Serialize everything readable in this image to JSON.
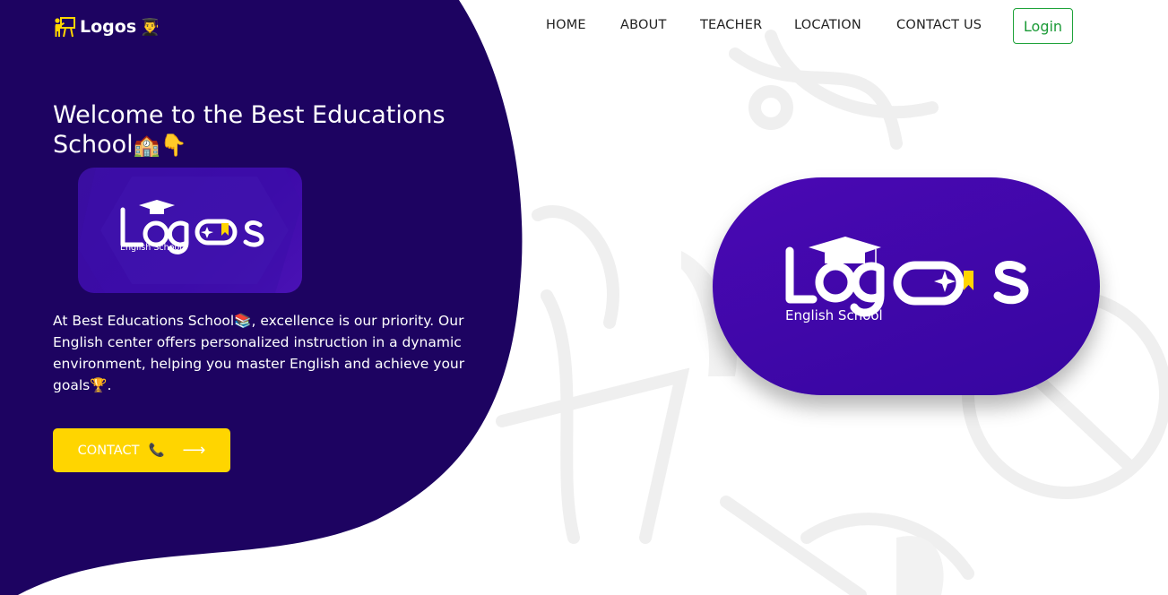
{
  "brand": {
    "name": "Logos",
    "teacher_icon": "teacher-board-icon",
    "grad_icon": "👨‍🎓"
  },
  "nav": {
    "items": [
      {
        "label": "HOME"
      },
      {
        "label": "ABOUT"
      },
      {
        "label": "TEACHER"
      },
      {
        "label": "LOCATION"
      },
      {
        "label": "CONTACT US"
      }
    ],
    "login_label": "Login"
  },
  "hero": {
    "title": "Welcome to the Best Educations School",
    "title_emojis": "🏫👇",
    "paragraph_part1": "At Best Educations School",
    "paragraph_emoji1": "📚",
    "paragraph_part2": ", excellence is our priority. Our English center offers personalized instruction in a dynamic environment, helping you master English and achieve your goals",
    "paragraph_emoji2": "🏆",
    "paragraph_end": ".",
    "cta_label": "CONTACT",
    "cta_emoji": "📞",
    "cta_arrow": "⟶"
  },
  "logo_card": {
    "wordmark": "Logos",
    "subtitle": "English School"
  },
  "colors": {
    "hero_bg": "#1d0361",
    "accent_yellow": "#ffd500",
    "login_green": "#1a9a36",
    "card_purple": "#3e08a8"
  }
}
